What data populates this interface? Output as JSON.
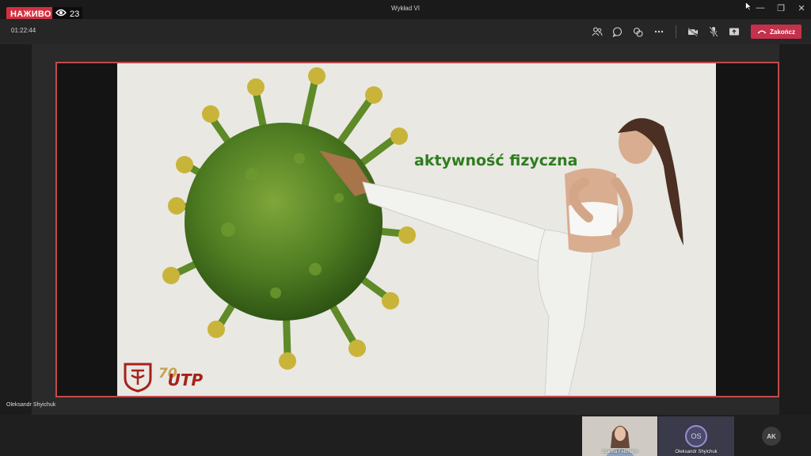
{
  "titlebar": {
    "live_label": "НАЖИВО",
    "viewer_count": "23",
    "title": "Wykład VI"
  },
  "toolbar": {
    "timer": "01:22:44",
    "end_label": "Zakończ",
    "end_color": "#c4314b"
  },
  "slide": {
    "caption": "aktywność fizyczna",
    "logo_number": "70",
    "logo_text": "UTP"
  },
  "stage": {
    "presenter_name": "Oleksandr Shyichuk"
  },
  "participants": [
    {
      "name": "Joanna Feldheim",
      "type": "video"
    },
    {
      "name": "Oleksandr Shyichuk",
      "initials": "OS",
      "type": "avatar"
    },
    {
      "initials": "AK",
      "type": "avatar"
    }
  ]
}
